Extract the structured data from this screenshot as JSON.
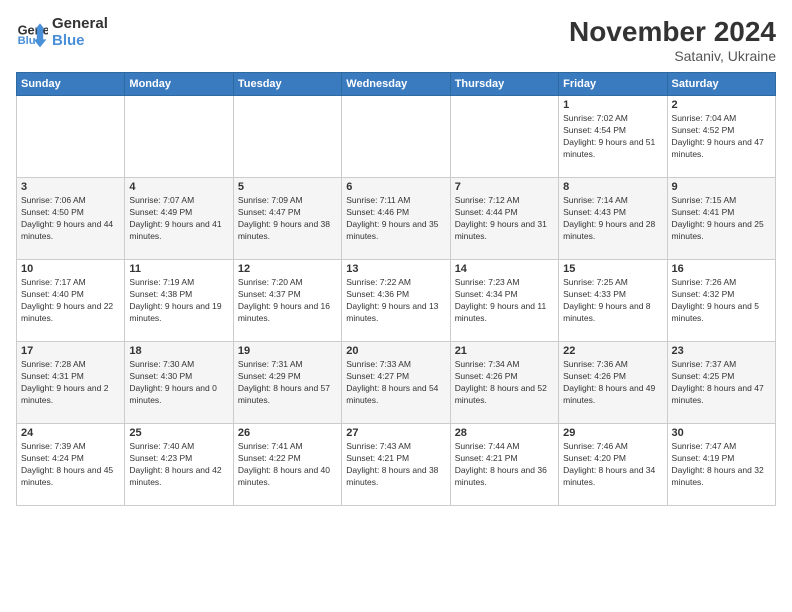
{
  "logo": {
    "line1": "General",
    "line2": "Blue"
  },
  "title": "November 2024",
  "location": "Sataniv, Ukraine",
  "days_of_week": [
    "Sunday",
    "Monday",
    "Tuesday",
    "Wednesday",
    "Thursday",
    "Friday",
    "Saturday"
  ],
  "weeks": [
    [
      {
        "day": "",
        "info": ""
      },
      {
        "day": "",
        "info": ""
      },
      {
        "day": "",
        "info": ""
      },
      {
        "day": "",
        "info": ""
      },
      {
        "day": "",
        "info": ""
      },
      {
        "day": "1",
        "info": "Sunrise: 7:02 AM\nSunset: 4:54 PM\nDaylight: 9 hours and 51 minutes."
      },
      {
        "day": "2",
        "info": "Sunrise: 7:04 AM\nSunset: 4:52 PM\nDaylight: 9 hours and 47 minutes."
      }
    ],
    [
      {
        "day": "3",
        "info": "Sunrise: 7:06 AM\nSunset: 4:50 PM\nDaylight: 9 hours and 44 minutes."
      },
      {
        "day": "4",
        "info": "Sunrise: 7:07 AM\nSunset: 4:49 PM\nDaylight: 9 hours and 41 minutes."
      },
      {
        "day": "5",
        "info": "Sunrise: 7:09 AM\nSunset: 4:47 PM\nDaylight: 9 hours and 38 minutes."
      },
      {
        "day": "6",
        "info": "Sunrise: 7:11 AM\nSunset: 4:46 PM\nDaylight: 9 hours and 35 minutes."
      },
      {
        "day": "7",
        "info": "Sunrise: 7:12 AM\nSunset: 4:44 PM\nDaylight: 9 hours and 31 minutes."
      },
      {
        "day": "8",
        "info": "Sunrise: 7:14 AM\nSunset: 4:43 PM\nDaylight: 9 hours and 28 minutes."
      },
      {
        "day": "9",
        "info": "Sunrise: 7:15 AM\nSunset: 4:41 PM\nDaylight: 9 hours and 25 minutes."
      }
    ],
    [
      {
        "day": "10",
        "info": "Sunrise: 7:17 AM\nSunset: 4:40 PM\nDaylight: 9 hours and 22 minutes."
      },
      {
        "day": "11",
        "info": "Sunrise: 7:19 AM\nSunset: 4:38 PM\nDaylight: 9 hours and 19 minutes."
      },
      {
        "day": "12",
        "info": "Sunrise: 7:20 AM\nSunset: 4:37 PM\nDaylight: 9 hours and 16 minutes."
      },
      {
        "day": "13",
        "info": "Sunrise: 7:22 AM\nSunset: 4:36 PM\nDaylight: 9 hours and 13 minutes."
      },
      {
        "day": "14",
        "info": "Sunrise: 7:23 AM\nSunset: 4:34 PM\nDaylight: 9 hours and 11 minutes."
      },
      {
        "day": "15",
        "info": "Sunrise: 7:25 AM\nSunset: 4:33 PM\nDaylight: 9 hours and 8 minutes."
      },
      {
        "day": "16",
        "info": "Sunrise: 7:26 AM\nSunset: 4:32 PM\nDaylight: 9 hours and 5 minutes."
      }
    ],
    [
      {
        "day": "17",
        "info": "Sunrise: 7:28 AM\nSunset: 4:31 PM\nDaylight: 9 hours and 2 minutes."
      },
      {
        "day": "18",
        "info": "Sunrise: 7:30 AM\nSunset: 4:30 PM\nDaylight: 9 hours and 0 minutes."
      },
      {
        "day": "19",
        "info": "Sunrise: 7:31 AM\nSunset: 4:29 PM\nDaylight: 8 hours and 57 minutes."
      },
      {
        "day": "20",
        "info": "Sunrise: 7:33 AM\nSunset: 4:27 PM\nDaylight: 8 hours and 54 minutes."
      },
      {
        "day": "21",
        "info": "Sunrise: 7:34 AM\nSunset: 4:26 PM\nDaylight: 8 hours and 52 minutes."
      },
      {
        "day": "22",
        "info": "Sunrise: 7:36 AM\nSunset: 4:26 PM\nDaylight: 8 hours and 49 minutes."
      },
      {
        "day": "23",
        "info": "Sunrise: 7:37 AM\nSunset: 4:25 PM\nDaylight: 8 hours and 47 minutes."
      }
    ],
    [
      {
        "day": "24",
        "info": "Sunrise: 7:39 AM\nSunset: 4:24 PM\nDaylight: 8 hours and 45 minutes."
      },
      {
        "day": "25",
        "info": "Sunrise: 7:40 AM\nSunset: 4:23 PM\nDaylight: 8 hours and 42 minutes."
      },
      {
        "day": "26",
        "info": "Sunrise: 7:41 AM\nSunset: 4:22 PM\nDaylight: 8 hours and 40 minutes."
      },
      {
        "day": "27",
        "info": "Sunrise: 7:43 AM\nSunset: 4:21 PM\nDaylight: 8 hours and 38 minutes."
      },
      {
        "day": "28",
        "info": "Sunrise: 7:44 AM\nSunset: 4:21 PM\nDaylight: 8 hours and 36 minutes."
      },
      {
        "day": "29",
        "info": "Sunrise: 7:46 AM\nSunset: 4:20 PM\nDaylight: 8 hours and 34 minutes."
      },
      {
        "day": "30",
        "info": "Sunrise: 7:47 AM\nSunset: 4:19 PM\nDaylight: 8 hours and 32 minutes."
      }
    ]
  ]
}
